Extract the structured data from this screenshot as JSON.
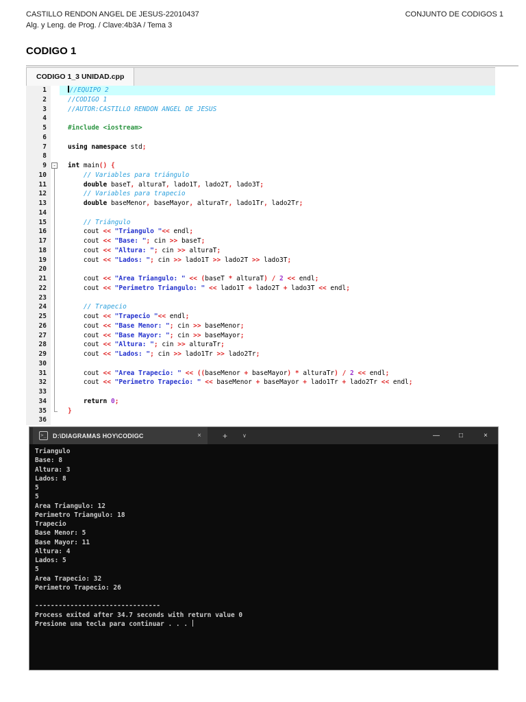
{
  "header": {
    "student": "CASTILLO RENDON ANGEL DE JESUS-22010437",
    "doc_label": "CONJUNTO DE CODIGOS 1",
    "course": "Alg. y Leng. de Prog. / Clave:4b3A / Tema 3",
    "section_title": "CODIGO 1"
  },
  "editor": {
    "tab_label": "CODIGO 1_3 UNIDAD.cpp",
    "syntax_colors": {
      "comment": "#2a9fdc",
      "string": "#2432cd",
      "keyword": "#000000",
      "symbol": "#e02a2a",
      "number": "#9c32cc",
      "preprocessor": "#2b9440",
      "line_highlight": "#ccffff"
    },
    "lines": [
      {
        "n": 1,
        "fold": "none",
        "hl": true,
        "cursor": true,
        "toks": [
          [
            "cm",
            "//EQUIPO 2"
          ]
        ]
      },
      {
        "n": 2,
        "fold": "none",
        "toks": [
          [
            "cm",
            "//CODIGO 1"
          ]
        ]
      },
      {
        "n": 3,
        "fold": "none",
        "toks": [
          [
            "cm",
            "//AUTOR:CASTILLO RENDON ANGEL DE JESUS"
          ]
        ]
      },
      {
        "n": 4,
        "fold": "none",
        "toks": []
      },
      {
        "n": 5,
        "fold": "none",
        "toks": [
          [
            "pre",
            "#include <iostream>"
          ]
        ]
      },
      {
        "n": 6,
        "fold": "none",
        "toks": []
      },
      {
        "n": 7,
        "fold": "none",
        "toks": [
          [
            "kw",
            "using"
          ],
          [
            "pl",
            " "
          ],
          [
            "kw",
            "namespace"
          ],
          [
            "pl",
            " std"
          ],
          [
            "op",
            ";"
          ]
        ]
      },
      {
        "n": 8,
        "fold": "none",
        "toks": []
      },
      {
        "n": 9,
        "fold": "start",
        "toks": [
          [
            "kw",
            "int"
          ],
          [
            "pl",
            " main"
          ],
          [
            "op",
            "()"
          ],
          [
            "pl",
            " "
          ],
          [
            "op",
            "{"
          ]
        ]
      },
      {
        "n": 10,
        "fold": "mid",
        "toks": [
          [
            "cm",
            "    // Variables para triángulo"
          ]
        ]
      },
      {
        "n": 11,
        "fold": "mid",
        "toks": [
          [
            "pl",
            "    "
          ],
          [
            "kw",
            "double"
          ],
          [
            "pl",
            " baseT"
          ],
          [
            "op",
            ","
          ],
          [
            "pl",
            " alturaT"
          ],
          [
            "op",
            ","
          ],
          [
            "pl",
            " lado1T"
          ],
          [
            "op",
            ","
          ],
          [
            "pl",
            " lado2T"
          ],
          [
            "op",
            ","
          ],
          [
            "pl",
            " lado3T"
          ],
          [
            "op",
            ";"
          ]
        ]
      },
      {
        "n": 12,
        "fold": "mid",
        "toks": [
          [
            "cm",
            "    // Variables para trapecio"
          ]
        ]
      },
      {
        "n": 13,
        "fold": "mid",
        "toks": [
          [
            "pl",
            "    "
          ],
          [
            "kw",
            "double"
          ],
          [
            "pl",
            " baseMenor"
          ],
          [
            "op",
            ","
          ],
          [
            "pl",
            " baseMayor"
          ],
          [
            "op",
            ","
          ],
          [
            "pl",
            " alturaTr"
          ],
          [
            "op",
            ","
          ],
          [
            "pl",
            " lado1Tr"
          ],
          [
            "op",
            ","
          ],
          [
            "pl",
            " lado2Tr"
          ],
          [
            "op",
            ";"
          ]
        ]
      },
      {
        "n": 14,
        "fold": "mid",
        "toks": []
      },
      {
        "n": 15,
        "fold": "mid",
        "toks": [
          [
            "cm",
            "    // Triángulo"
          ]
        ]
      },
      {
        "n": 16,
        "fold": "mid",
        "toks": [
          [
            "pl",
            "    cout "
          ],
          [
            "op",
            "<<"
          ],
          [
            "pl",
            " "
          ],
          [
            "str",
            "\"Triangulo \""
          ],
          [
            "op",
            "<<"
          ],
          [
            "pl",
            " endl"
          ],
          [
            "op",
            ";"
          ]
        ]
      },
      {
        "n": 17,
        "fold": "mid",
        "toks": [
          [
            "pl",
            "    cout "
          ],
          [
            "op",
            "<<"
          ],
          [
            "pl",
            " "
          ],
          [
            "str",
            "\"Base: \""
          ],
          [
            "op",
            ";"
          ],
          [
            "pl",
            " cin "
          ],
          [
            "op",
            ">>"
          ],
          [
            "pl",
            " baseT"
          ],
          [
            "op",
            ";"
          ]
        ]
      },
      {
        "n": 18,
        "fold": "mid",
        "toks": [
          [
            "pl",
            "    cout "
          ],
          [
            "op",
            "<<"
          ],
          [
            "pl",
            " "
          ],
          [
            "str",
            "\"Altura: \""
          ],
          [
            "op",
            ";"
          ],
          [
            "pl",
            " cin "
          ],
          [
            "op",
            ">>"
          ],
          [
            "pl",
            " alturaT"
          ],
          [
            "op",
            ";"
          ]
        ]
      },
      {
        "n": 19,
        "fold": "mid",
        "toks": [
          [
            "pl",
            "    cout "
          ],
          [
            "op",
            "<<"
          ],
          [
            "pl",
            " "
          ],
          [
            "str",
            "\"Lados: \""
          ],
          [
            "op",
            ";"
          ],
          [
            "pl",
            " cin "
          ],
          [
            "op",
            ">>"
          ],
          [
            "pl",
            " lado1T "
          ],
          [
            "op",
            ">>"
          ],
          [
            "pl",
            " lado2T "
          ],
          [
            "op",
            ">>"
          ],
          [
            "pl",
            " lado3T"
          ],
          [
            "op",
            ";"
          ]
        ]
      },
      {
        "n": 20,
        "fold": "mid",
        "toks": []
      },
      {
        "n": 21,
        "fold": "mid",
        "toks": [
          [
            "pl",
            "    cout "
          ],
          [
            "op",
            "<<"
          ],
          [
            "pl",
            " "
          ],
          [
            "str",
            "\"Area Triangulo: \""
          ],
          [
            "pl",
            " "
          ],
          [
            "op",
            "<<"
          ],
          [
            "pl",
            " "
          ],
          [
            "op",
            "("
          ],
          [
            "pl",
            "baseT "
          ],
          [
            "op",
            "*"
          ],
          [
            "pl",
            " alturaT"
          ],
          [
            "op",
            ")"
          ],
          [
            "pl",
            " "
          ],
          [
            "op",
            "/"
          ],
          [
            "pl",
            " "
          ],
          [
            "num",
            "2"
          ],
          [
            "pl",
            " "
          ],
          [
            "op",
            "<<"
          ],
          [
            "pl",
            " endl"
          ],
          [
            "op",
            ";"
          ]
        ]
      },
      {
        "n": 22,
        "fold": "mid",
        "toks": [
          [
            "pl",
            "    cout "
          ],
          [
            "op",
            "<<"
          ],
          [
            "pl",
            " "
          ],
          [
            "str",
            "\"Perimetro Triangulo: \""
          ],
          [
            "pl",
            " "
          ],
          [
            "op",
            "<<"
          ],
          [
            "pl",
            " lado1T "
          ],
          [
            "op",
            "+"
          ],
          [
            "pl",
            " lado2T "
          ],
          [
            "op",
            "+"
          ],
          [
            "pl",
            " lado3T "
          ],
          [
            "op",
            "<<"
          ],
          [
            "pl",
            " endl"
          ],
          [
            "op",
            ";"
          ]
        ]
      },
      {
        "n": 23,
        "fold": "mid",
        "toks": []
      },
      {
        "n": 24,
        "fold": "mid",
        "toks": [
          [
            "cm",
            "    // Trapecio"
          ]
        ]
      },
      {
        "n": 25,
        "fold": "mid",
        "toks": [
          [
            "pl",
            "    cout "
          ],
          [
            "op",
            "<<"
          ],
          [
            "pl",
            " "
          ],
          [
            "str",
            "\"Trapecio \""
          ],
          [
            "op",
            "<<"
          ],
          [
            "pl",
            " endl"
          ],
          [
            "op",
            ";"
          ]
        ]
      },
      {
        "n": 26,
        "fold": "mid",
        "toks": [
          [
            "pl",
            "    cout "
          ],
          [
            "op",
            "<<"
          ],
          [
            "pl",
            " "
          ],
          [
            "str",
            "\"Base Menor: \""
          ],
          [
            "op",
            ";"
          ],
          [
            "pl",
            " cin "
          ],
          [
            "op",
            ">>"
          ],
          [
            "pl",
            " baseMenor"
          ],
          [
            "op",
            ";"
          ]
        ]
      },
      {
        "n": 27,
        "fold": "mid",
        "toks": [
          [
            "pl",
            "    cout "
          ],
          [
            "op",
            "<<"
          ],
          [
            "pl",
            " "
          ],
          [
            "str",
            "\"Base Mayor: \""
          ],
          [
            "op",
            ";"
          ],
          [
            "pl",
            " cin "
          ],
          [
            "op",
            ">>"
          ],
          [
            "pl",
            " baseMayor"
          ],
          [
            "op",
            ";"
          ]
        ]
      },
      {
        "n": 28,
        "fold": "mid",
        "toks": [
          [
            "pl",
            "    cout "
          ],
          [
            "op",
            "<<"
          ],
          [
            "pl",
            " "
          ],
          [
            "str",
            "\"Altura: \""
          ],
          [
            "op",
            ";"
          ],
          [
            "pl",
            " cin "
          ],
          [
            "op",
            ">>"
          ],
          [
            "pl",
            " alturaTr"
          ],
          [
            "op",
            ";"
          ]
        ]
      },
      {
        "n": 29,
        "fold": "mid",
        "toks": [
          [
            "pl",
            "    cout "
          ],
          [
            "op",
            "<<"
          ],
          [
            "pl",
            " "
          ],
          [
            "str",
            "\"Lados: \""
          ],
          [
            "op",
            ";"
          ],
          [
            "pl",
            " cin "
          ],
          [
            "op",
            ">>"
          ],
          [
            "pl",
            " lado1Tr "
          ],
          [
            "op",
            ">>"
          ],
          [
            "pl",
            " lado2Tr"
          ],
          [
            "op",
            ";"
          ]
        ]
      },
      {
        "n": 30,
        "fold": "mid",
        "toks": []
      },
      {
        "n": 31,
        "fold": "mid",
        "toks": [
          [
            "pl",
            "    cout "
          ],
          [
            "op",
            "<<"
          ],
          [
            "pl",
            " "
          ],
          [
            "str",
            "\"Area Trapecio: \""
          ],
          [
            "pl",
            " "
          ],
          [
            "op",
            "<<"
          ],
          [
            "pl",
            " "
          ],
          [
            "op",
            "(("
          ],
          [
            "pl",
            "baseMenor "
          ],
          [
            "op",
            "+"
          ],
          [
            "pl",
            " baseMayor"
          ],
          [
            "op",
            ")"
          ],
          [
            "pl",
            " "
          ],
          [
            "op",
            "*"
          ],
          [
            "pl",
            " alturaTr"
          ],
          [
            "op",
            ")"
          ],
          [
            "pl",
            " "
          ],
          [
            "op",
            "/"
          ],
          [
            "pl",
            " "
          ],
          [
            "num",
            "2"
          ],
          [
            "pl",
            " "
          ],
          [
            "op",
            "<<"
          ],
          [
            "pl",
            " endl"
          ],
          [
            "op",
            ";"
          ]
        ]
      },
      {
        "n": 32,
        "fold": "mid",
        "toks": [
          [
            "pl",
            "    cout "
          ],
          [
            "op",
            "<<"
          ],
          [
            "pl",
            " "
          ],
          [
            "str",
            "\"Perimetro Trapecio: \""
          ],
          [
            "pl",
            " "
          ],
          [
            "op",
            "<<"
          ],
          [
            "pl",
            " baseMenor "
          ],
          [
            "op",
            "+"
          ],
          [
            "pl",
            " baseMayor "
          ],
          [
            "op",
            "+"
          ],
          [
            "pl",
            " lado1Tr "
          ],
          [
            "op",
            "+"
          ],
          [
            "pl",
            " lado2Tr "
          ],
          [
            "op",
            "<<"
          ],
          [
            "pl",
            " endl"
          ],
          [
            "op",
            ";"
          ]
        ]
      },
      {
        "n": 33,
        "fold": "mid",
        "toks": []
      },
      {
        "n": 34,
        "fold": "mid",
        "toks": [
          [
            "pl",
            "    "
          ],
          [
            "kw",
            "return"
          ],
          [
            "pl",
            " "
          ],
          [
            "num",
            "0"
          ],
          [
            "op",
            ";"
          ]
        ]
      },
      {
        "n": 35,
        "fold": "end",
        "toks": [
          [
            "op",
            "}"
          ]
        ]
      },
      {
        "n": 36,
        "fold": "none",
        "toks": []
      }
    ]
  },
  "terminal": {
    "tab_icon_glyph": ">_",
    "tab_title": "D:\\DIAGRAMAS HOY\\CODIGC",
    "tab_close": "×",
    "new_tab": "+",
    "tab_dropdown": "∨",
    "minimize": "—",
    "maximize": "□",
    "close": "×",
    "background": "#0c0c0c",
    "text_color": "#cccccc",
    "lines": [
      "Triangulo",
      "Base: 8",
      "Altura: 3",
      "Lados: 8",
      "5",
      "5",
      "Area Triangulo: 12",
      "Perimetro Triangulo: 18",
      "Trapecio",
      "Base Menor: 5",
      "Base Mayor: 11",
      "Altura: 4",
      "Lados: 5",
      "5",
      "Area Trapecio: 32",
      "Perimetro Trapecio: 26",
      "",
      "--------------------------------",
      "Process exited after 34.7 seconds with return value 0",
      "Presione una tecla para continuar . . . "
    ],
    "cursor_line_index": 19
  }
}
